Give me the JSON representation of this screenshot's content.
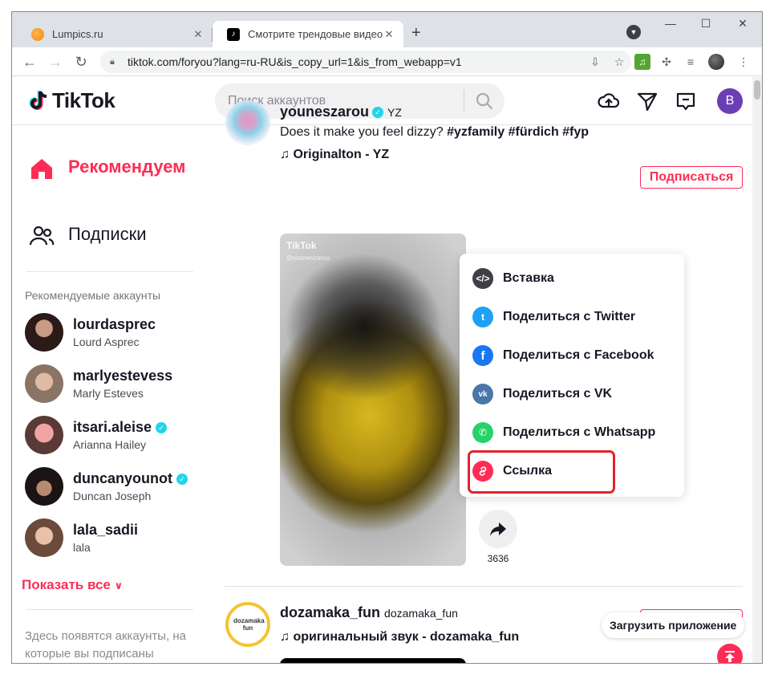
{
  "browser": {
    "tabs": [
      {
        "title": "Lumpics.ru",
        "close": "✕"
      },
      {
        "title": "Смотрите трендовые видео | TikTok",
        "close": "✕"
      }
    ],
    "new_tab": "+",
    "url": "tiktok.com/foryou?lang=ru-RU&is_copy_url=1&is_from_webapp=v1",
    "window_controls": {
      "minimize": "—",
      "maximize": "☐",
      "close": "✕"
    }
  },
  "header": {
    "logo_text": "TikTok",
    "search_placeholder": "Поиск аккаунтов",
    "user_initial": "B"
  },
  "sidebar": {
    "nav": [
      {
        "label": "Рекомендуем",
        "active": true
      },
      {
        "label": "Подписки",
        "active": false
      }
    ],
    "suggested_label": "Рекомендуемые аккаунты",
    "accounts": [
      {
        "username": "lourdasprec",
        "name": "Lourd Asprec",
        "verified": false
      },
      {
        "username": "marlyestevess",
        "name": "Marly Esteves",
        "verified": false
      },
      {
        "username": "itsari.aleise",
        "name": "Arianna Hailey",
        "verified": true
      },
      {
        "username": "duncanyounot",
        "name": "Duncan Joseph",
        "verified": true
      },
      {
        "username": "lala_sadii",
        "name": "lala",
        "verified": false
      }
    ],
    "show_all": "Показать все",
    "following_hint": "Здесь появятся аккаунты, на которые вы подписаны"
  },
  "feed": {
    "post1": {
      "username": "youneszarou",
      "nickname": "YZ",
      "description": "Does it make you feel dizzy?",
      "hashtags": "#yzfamily #fürdich #fyp",
      "music": "Originalton - YZ",
      "follow_label": "Подписаться",
      "watermark": "TikTok",
      "watermark_user": "@youneszarou",
      "share_count": "3636"
    },
    "post2": {
      "username": "dozamaka_fun",
      "nickname": "dozamaka_fun",
      "music": "оригинальный звук - dozamaka_fun",
      "avatar_text": "dozamaka fun"
    }
  },
  "share_menu": {
    "items": [
      {
        "label": "Вставка",
        "icon": "embed-icon",
        "color": "#3f4046"
      },
      {
        "label": "Поделиться с Twitter",
        "icon": "twitter-icon",
        "color": "#1da1f2"
      },
      {
        "label": "Поделиться с Facebook",
        "icon": "facebook-icon",
        "color": "#1877f2"
      },
      {
        "label": "Поделиться с VK",
        "icon": "vk-icon",
        "color": "#4a76a8"
      },
      {
        "label": "Поделиться с Whatsapp",
        "icon": "whatsapp-icon",
        "color": "#25d366"
      },
      {
        "label": "Ссылка",
        "icon": "link-icon",
        "color": "#fe2c55"
      }
    ]
  },
  "get_app_label": "Загрузить приложение",
  "colors": {
    "brand": "#fe2c55",
    "highlight": "#e2232b"
  }
}
